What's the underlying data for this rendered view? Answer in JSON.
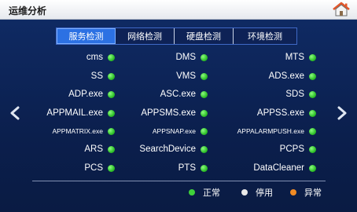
{
  "header": {
    "title": "运维分析",
    "home_icon": "home-icon"
  },
  "tabs": [
    {
      "label": "服务检测",
      "active": true
    },
    {
      "label": "网络检测",
      "active": false
    },
    {
      "label": "硬盘检测",
      "active": false
    },
    {
      "label": "环境检测",
      "active": false
    }
  ],
  "services": {
    "rows": [
      [
        {
          "name": "cms",
          "status": "normal"
        },
        {
          "name": "DMS",
          "status": "normal"
        },
        {
          "name": "MTS",
          "status": "normal"
        }
      ],
      [
        {
          "name": "SS",
          "status": "normal"
        },
        {
          "name": "VMS",
          "status": "normal"
        },
        {
          "name": "ADS.exe",
          "status": "normal"
        }
      ],
      [
        {
          "name": "ADP.exe",
          "status": "normal"
        },
        {
          "name": "ASC.exe",
          "status": "normal"
        },
        {
          "name": "SDS",
          "status": "normal"
        }
      ],
      [
        {
          "name": "APPMAIL.exe",
          "status": "normal"
        },
        {
          "name": "APPSMS.exe",
          "status": "normal"
        },
        {
          "name": "APPSS.exe",
          "status": "normal"
        }
      ],
      [
        {
          "name": "APPMATRIX.exe",
          "status": "normal"
        },
        {
          "name": "APPSNAP.exe",
          "status": "normal"
        },
        {
          "name": "APPALARMPUSH.exe",
          "status": "normal"
        }
      ],
      [
        {
          "name": "ARS",
          "status": "normal"
        },
        {
          "name": "SearchDevice",
          "status": "normal"
        },
        {
          "name": "PCPS",
          "status": "normal"
        }
      ],
      [
        {
          "name": "PCS",
          "status": "normal"
        },
        {
          "name": "PTS",
          "status": "normal"
        },
        {
          "name": "DataCleaner",
          "status": "normal"
        }
      ]
    ]
  },
  "nav": {
    "prev_icon": "chevron-left-icon",
    "next_icon": "chevron-right-icon"
  },
  "legend": [
    {
      "label": "正常",
      "color": "#3fd23a"
    },
    {
      "label": "停用",
      "color": "#e9e9e9"
    },
    {
      "label": "异常",
      "color": "#f08a24"
    }
  ],
  "colors": {
    "normal": "#3fd23a",
    "disabled": "#e9e9e9",
    "error": "#f08a24",
    "active_tab": "#2c71e3"
  }
}
